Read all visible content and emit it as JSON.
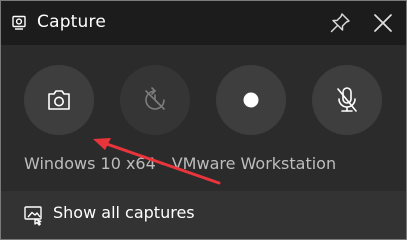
{
  "window": {
    "title": "Capture",
    "icons": {
      "app": "capture-icon",
      "pin": "pin-icon",
      "close": "close-icon"
    }
  },
  "buttons": [
    {
      "name": "screenshot",
      "icon": "camera-icon",
      "enabled": true
    },
    {
      "name": "record-last-30s",
      "icon": "replay-icon",
      "enabled": false
    },
    {
      "name": "start-recording",
      "icon": "record-dot-icon",
      "enabled": true
    },
    {
      "name": "microphone",
      "icon": "mic-off-icon",
      "enabled": true
    }
  ],
  "source_label": "Windows 10 x64 - VMware Workstation",
  "footer": {
    "label": "Show all captures",
    "icon": "gallery-icon"
  },
  "colors": {
    "titlebar": "#1c1c1c",
    "panel": "#2b2b2b",
    "footer": "#333333",
    "button": "#3e3e3e",
    "annotation_arrow": "#e8353b"
  }
}
